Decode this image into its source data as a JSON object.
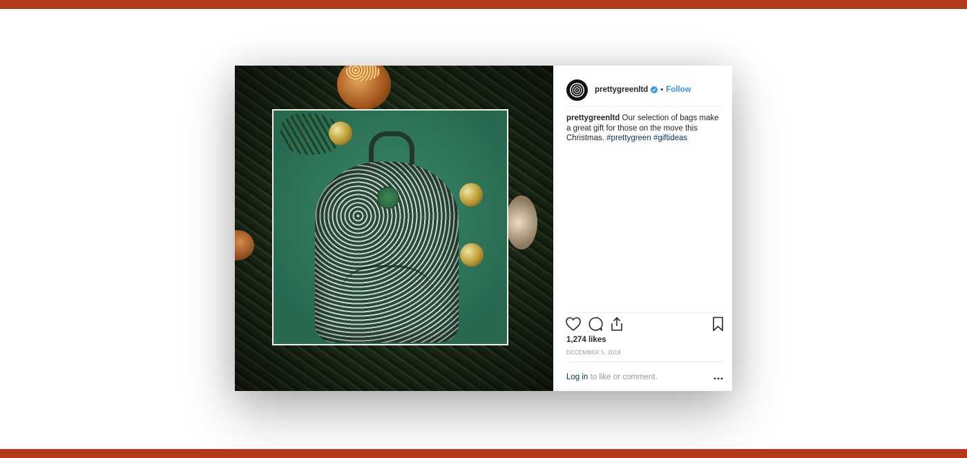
{
  "post": {
    "username": "prettygreenltd",
    "follow_label": "Follow",
    "separator": "•",
    "caption": {
      "user": "prettygreenltd",
      "text": " Our selection of bags make a great gift for those on the move this Christmas. ",
      "tags": [
        "#prettygreen",
        "#giftideas"
      ]
    },
    "likes": "1,274 likes",
    "date": "DECEMBER 5, 2018",
    "login_link": "Log in",
    "login_suffix": " to like or comment.",
    "icons": [
      "heart-icon",
      "comment-icon",
      "share-icon",
      "bookmark-icon",
      "more-icon",
      "verified-icon"
    ]
  },
  "colors": {
    "band": "#b2391a",
    "follow": "#3897f0",
    "hashtag": "#003569",
    "frame_bg": "#2f7a5e"
  }
}
